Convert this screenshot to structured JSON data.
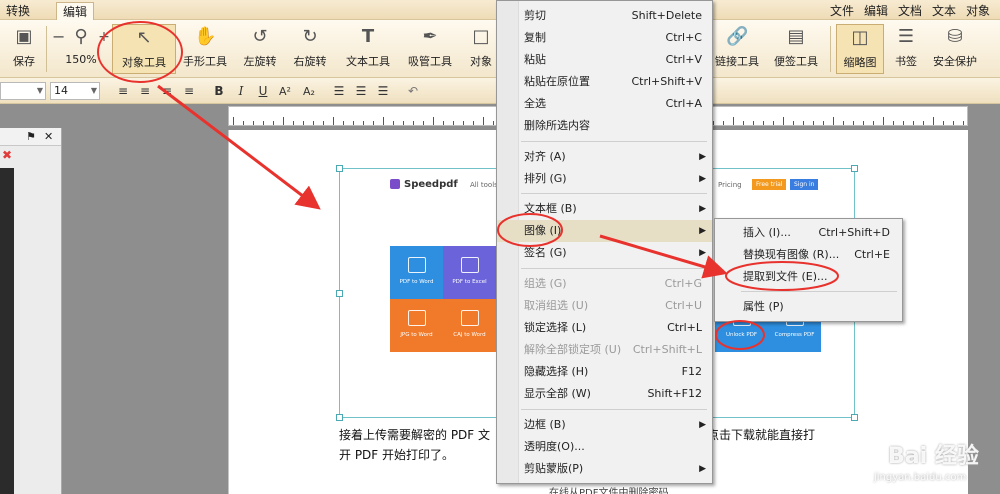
{
  "menubar": {
    "tabs": [
      "转换",
      "编辑"
    ],
    "right_menus": [
      "文件",
      "编辑",
      "文档",
      "文本",
      "对象"
    ]
  },
  "ribbon": {
    "save": "保存",
    "zoom": "150%",
    "zoom_minus": "−",
    "zoom_plus": "+",
    "tools": [
      "对象工具",
      "手形工具",
      "左旋转",
      "右旋转",
      "文本工具",
      "吸管工具",
      "对象"
    ],
    "tools_right": [
      "链接工具",
      "便签工具",
      "缩略图",
      "书签",
      "安全保护"
    ]
  },
  "format": {
    "font_size": "14",
    "bold": "B",
    "italic": "I",
    "underline": "U",
    "superscript": "A²",
    "subscript": "A₂"
  },
  "context_menu": {
    "items": [
      {
        "label": "剪切",
        "shortcut": "Shift+Delete"
      },
      {
        "label": "复制",
        "shortcut": "Ctrl+C"
      },
      {
        "label": "粘贴",
        "shortcut": "Ctrl+V"
      },
      {
        "label": "粘贴在原位置",
        "shortcut": "Ctrl+Shift+V"
      },
      {
        "label": "全选",
        "shortcut": "Ctrl+A"
      },
      {
        "label": "删除所选内容",
        "shortcut": ""
      },
      {
        "label": "对齐 (A)",
        "shortcut": ""
      },
      {
        "label": "排列 (G)",
        "shortcut": ""
      },
      {
        "label": "文本框 (B)",
        "shortcut": ""
      },
      {
        "label": "图像 (I)",
        "shortcut": ""
      },
      {
        "label": "签名 (G)",
        "shortcut": ""
      },
      {
        "label": "组选 (G)",
        "shortcut": "Ctrl+G"
      },
      {
        "label": "取消组选 (U)",
        "shortcut": "Ctrl+U"
      },
      {
        "label": "锁定选择 (L)",
        "shortcut": "Ctrl+L"
      },
      {
        "label": "解除全部锁定项 (U)",
        "shortcut": "Ctrl+Shift+L"
      },
      {
        "label": "隐藏选择 (H)",
        "shortcut": "F12"
      },
      {
        "label": "显示全部 (W)",
        "shortcut": "Shift+F12"
      },
      {
        "label": "边框 (B)",
        "shortcut": ""
      },
      {
        "label": "透明度(O)...",
        "shortcut": ""
      },
      {
        "label": "剪贴蒙版(P)",
        "shortcut": ""
      }
    ]
  },
  "submenu": {
    "items": [
      {
        "label": "插入 (I)...",
        "shortcut": "Ctrl+Shift+D"
      },
      {
        "label": "替换现有图像 (R)...",
        "shortcut": "Ctrl+E"
      },
      {
        "label": "提取到文件 (E)...",
        "shortcut": ""
      },
      {
        "label": "属性 (P)",
        "shortcut": ""
      }
    ]
  },
  "page": {
    "brand": "Speedpdf",
    "nav": "All tools",
    "nav2": "Pricing",
    "btn_free": "Free trial",
    "btn_signin": "Sign in",
    "tiles": [
      "PDF to Word",
      "PDF to Excel",
      "JPG to Word",
      "CAJ to Word",
      "Unlock PDF",
      "Compress PDF"
    ],
    "caption_line1": "接着上传需要解密的 PDF 文",
    "caption_line1_tail": "功后点击下载就能直接打",
    "caption_line2": "开 PDF 开始打印了。",
    "footer_hint": "在线从PDF文件中删除密码"
  },
  "watermark": {
    "brand": "Bai 经验",
    "url": "jingyan.baidu.com"
  },
  "colors": {
    "annotation_red": "#e8322d",
    "tile_blue": "#2e8fe0",
    "tile_purple": "#6b63d9",
    "tile_orange": "#f07a2a",
    "brand_purple": "#7a4cc9",
    "btn_orange": "#f39a1e",
    "btn_blue": "#3a7de0"
  }
}
